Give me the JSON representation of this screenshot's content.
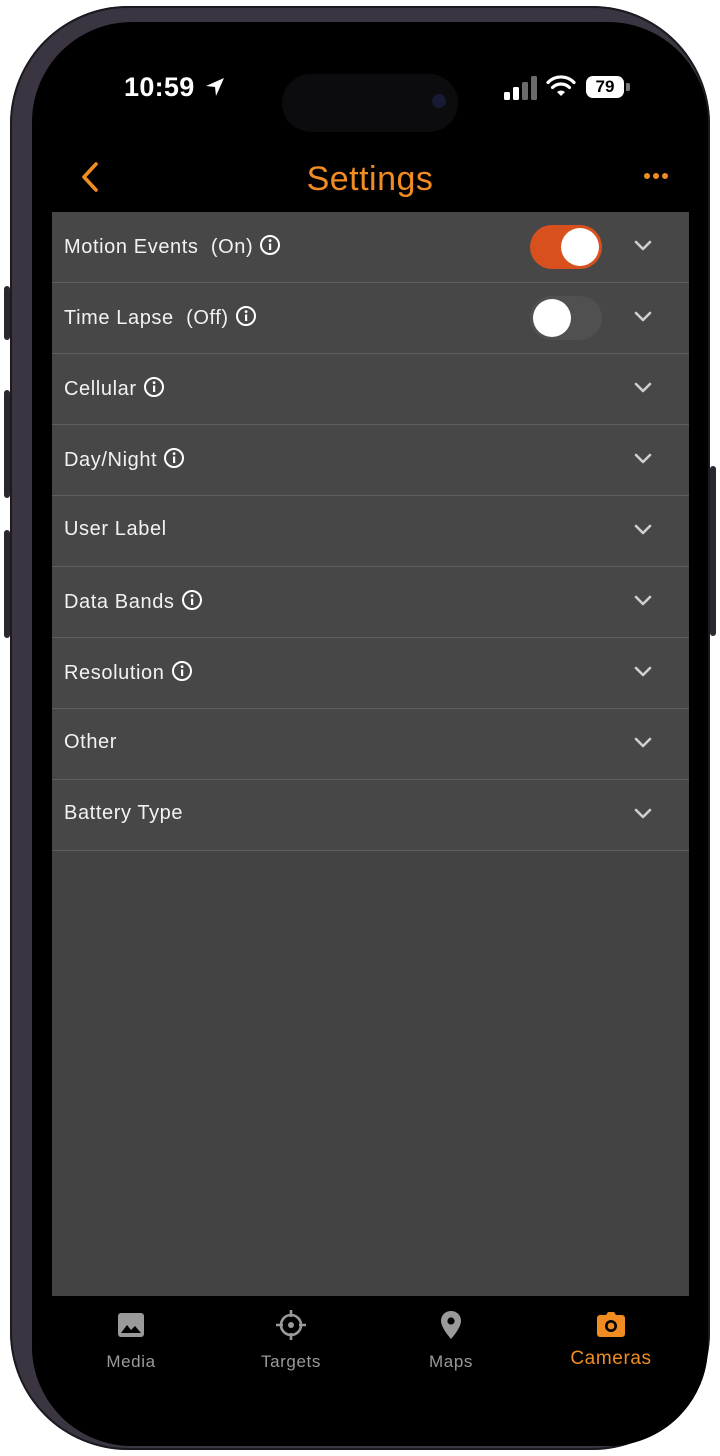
{
  "status": {
    "time": "10:59",
    "battery": "79"
  },
  "nav": {
    "title": "Settings"
  },
  "rows": [
    {
      "label": "Motion Events  (On)",
      "info": true,
      "toggle": "on"
    },
    {
      "label": "Time Lapse  (Off)",
      "info": true,
      "toggle": "off"
    },
    {
      "label": "Cellular",
      "info": true
    },
    {
      "label": "Day/Night",
      "info": true
    },
    {
      "label": "User Label",
      "info": false
    },
    {
      "label": "Data Bands",
      "info": true
    },
    {
      "label": "Resolution",
      "info": true
    },
    {
      "label": "Other",
      "info": false
    },
    {
      "label": "Battery Type",
      "info": false
    }
  ],
  "tabs": [
    {
      "label": "Media",
      "icon": "image-icon"
    },
    {
      "label": "Targets",
      "icon": "crosshair-icon"
    },
    {
      "label": "Maps",
      "icon": "map-pin-icon"
    },
    {
      "label": "Cameras",
      "icon": "camera-icon",
      "active": true
    }
  ],
  "colors": {
    "accent": "#f08c22",
    "toggle_on": "#d8501d",
    "panel": "#434343"
  }
}
